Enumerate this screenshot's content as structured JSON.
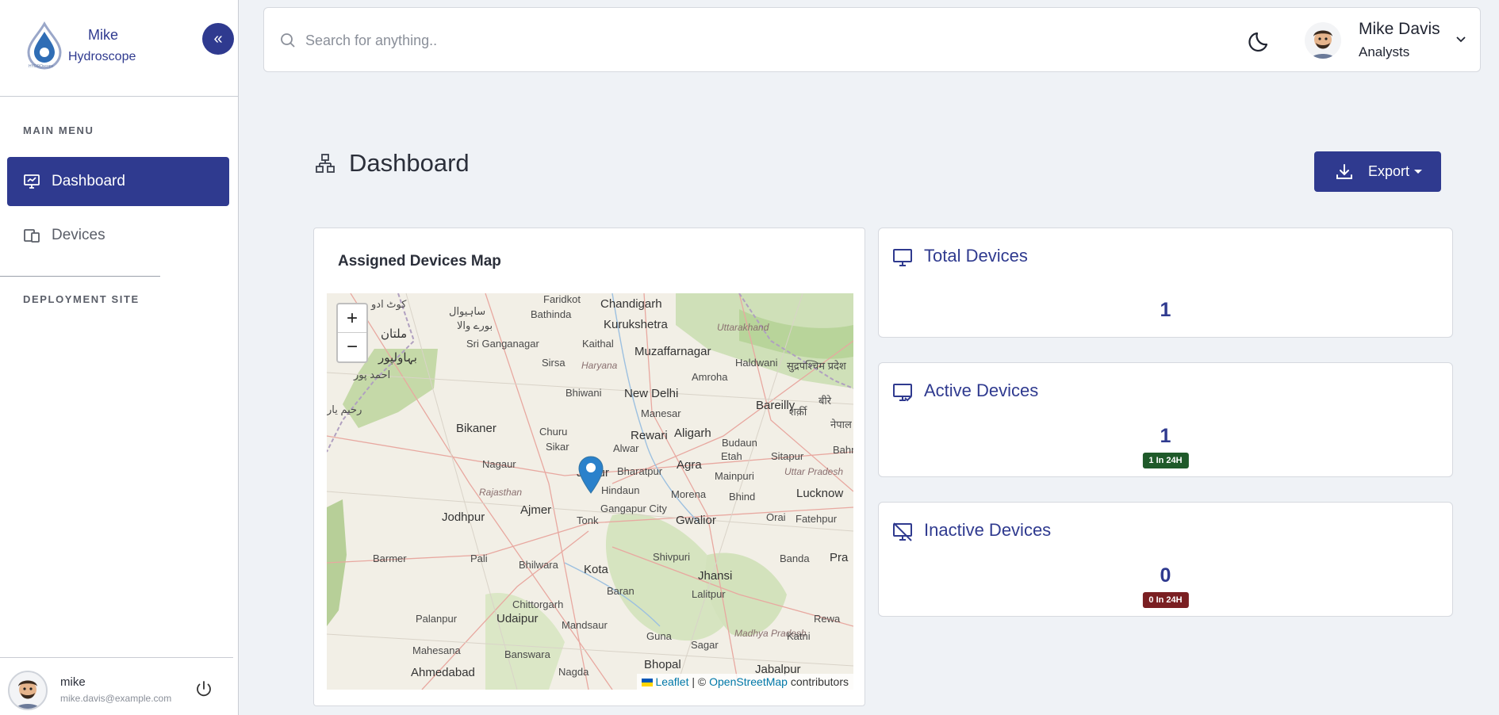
{
  "sidebar": {
    "brand_line1": "Mike",
    "brand_line2": "Hydroscope",
    "logo_caption": "HYDROscope",
    "collapse_glyph": "«",
    "main_menu_title": "MAIN MENU",
    "items": [
      {
        "label": "Dashboard",
        "icon": "monitor-chart-icon",
        "active": true
      },
      {
        "label": "Devices",
        "icon": "devices-icon",
        "active": false
      }
    ],
    "deployment_title": "DEPLOYMENT SITE",
    "footer": {
      "name": "mike",
      "email": "mike.davis@example.com"
    }
  },
  "topbar": {
    "search_placeholder": "Search for anything..",
    "profile_name": "Mike Davis",
    "profile_role": "Analysts"
  },
  "page": {
    "title": "Dashboard",
    "export_label": "Export"
  },
  "map_card": {
    "title": "Assigned Devices Map",
    "zoom_in": "+",
    "zoom_out": "−",
    "attribution_leaflet": "Leaflet",
    "attribution_sep": " | © ",
    "attribution_osm": "OpenStreetMap",
    "attribution_tail": " contributors",
    "labels": [
      {
        "t": "Faridkot",
        "c": ""
      },
      {
        "t": "Chandigarh",
        "c": "big"
      },
      {
        "t": "Bathinda",
        "c": ""
      },
      {
        "t": "Kurukshetra",
        "c": "big"
      },
      {
        "t": "Uttarakhand",
        "c": "italic"
      },
      {
        "t": "Sri Ganganagar",
        "c": ""
      },
      {
        "t": "Kaithal",
        "c": ""
      },
      {
        "t": "Muzaffarnagar",
        "c": "big"
      },
      {
        "t": "Sirsa",
        "c": ""
      },
      {
        "t": "Haryana",
        "c": "italic"
      },
      {
        "t": "Haldwani",
        "c": ""
      },
      {
        "t": "Amroha",
        "c": ""
      },
      {
        "t": "Bhiwani",
        "c": ""
      },
      {
        "t": "New Delhi",
        "c": "big"
      },
      {
        "t": "Manesar",
        "c": ""
      },
      {
        "t": "Bareilly",
        "c": "big"
      },
      {
        "t": "Bikaner",
        "c": "big"
      },
      {
        "t": "Churu",
        "c": ""
      },
      {
        "t": "Rewari",
        "c": "big"
      },
      {
        "t": "Aligarh",
        "c": "big"
      },
      {
        "t": "Budaun",
        "c": ""
      },
      {
        "t": "Sikar",
        "c": ""
      },
      {
        "t": "Alwar",
        "c": ""
      },
      {
        "t": "Nagaur",
        "c": ""
      },
      {
        "t": "Bharatpur",
        "c": ""
      },
      {
        "t": "Agra",
        "c": "big"
      },
      {
        "t": "Etah",
        "c": ""
      },
      {
        "t": "Sitapur",
        "c": ""
      },
      {
        "t": "Jaipur",
        "c": "big"
      },
      {
        "t": "Mainpuri",
        "c": ""
      },
      {
        "t": "Uttar Pradesh",
        "c": "italic"
      },
      {
        "t": "Rajasthan",
        "c": "italic"
      },
      {
        "t": "Hindaun",
        "c": ""
      },
      {
        "t": "Morena",
        "c": ""
      },
      {
        "t": "Lucknow",
        "c": "big"
      },
      {
        "t": "Bhind",
        "c": ""
      },
      {
        "t": "Ajmer",
        "c": "big"
      },
      {
        "t": "Gangapur City",
        "c": ""
      },
      {
        "t": "Jodhpur",
        "c": "big"
      },
      {
        "t": "Tonk",
        "c": ""
      },
      {
        "t": "Gwalior",
        "c": "big"
      },
      {
        "t": "Orai",
        "c": ""
      },
      {
        "t": "Fatehpur",
        "c": ""
      },
      {
        "t": "Barmer",
        "c": ""
      },
      {
        "t": "Pali",
        "c": ""
      },
      {
        "t": "Bhilwara",
        "c": ""
      },
      {
        "t": "Shivpuri",
        "c": ""
      },
      {
        "t": "Banda",
        "c": ""
      },
      {
        "t": "Kota",
        "c": "big"
      },
      {
        "t": "Jhansi",
        "c": "big"
      },
      {
        "t": "Baran",
        "c": ""
      },
      {
        "t": "Lalitpur",
        "c": ""
      },
      {
        "t": "Chittorgarh",
        "c": ""
      },
      {
        "t": "Palanpur",
        "c": ""
      },
      {
        "t": "Udaipur",
        "c": "big"
      },
      {
        "t": "Mandsaur",
        "c": ""
      },
      {
        "t": "Guna",
        "c": ""
      },
      {
        "t": "Madhya Pradesh",
        "c": "italic"
      },
      {
        "t": "Katni",
        "c": ""
      },
      {
        "t": "Rewa",
        "c": ""
      },
      {
        "t": "Mahesana",
        "c": ""
      },
      {
        "t": "Banswara",
        "c": ""
      },
      {
        "t": "Sagar",
        "c": ""
      },
      {
        "t": "Bhopal",
        "c": "big"
      },
      {
        "t": "Ahmedabad",
        "c": "big"
      },
      {
        "t": "Nagda",
        "c": ""
      },
      {
        "t": "Jabalpur",
        "c": "big"
      },
      {
        "t": "Pra",
        "c": "big"
      },
      {
        "t": "Bahr",
        "c": ""
      },
      {
        "t": "ملتان",
        "c": "big"
      },
      {
        "t": "بہاولپور",
        "c": "big"
      },
      {
        "t": "رحیم یار",
        "c": ""
      },
      {
        "t": "احمد پور",
        "c": ""
      },
      {
        "t": "کوٹ ادو",
        "c": ""
      },
      {
        "t": "ساہیوال",
        "c": ""
      },
      {
        "t": "بورے والا",
        "c": ""
      },
      {
        "t": "शर्क़ी",
        "c": ""
      },
      {
        "t": "सुद्रपश्चिम प्रदेश",
        "c": ""
      },
      {
        "t": "नेपाल",
        "c": ""
      },
      {
        "t": "बीरे",
        "c": ""
      }
    ]
  },
  "stats": [
    {
      "title": "Total Devices",
      "value": "1",
      "badge": "",
      "icon": "monitor-icon"
    },
    {
      "title": "Active Devices",
      "value": "1",
      "badge": "1 In 24H",
      "badge_color": "#1f5a2a",
      "icon": "monitor-check-icon"
    },
    {
      "title": "Inactive Devices",
      "value": "0",
      "badge": "0 In 24H",
      "badge_color": "#7a1f22",
      "icon": "monitor-off-icon"
    }
  ],
  "colors": {
    "accent": "#2f3a8f",
    "active_badge": "#1f5a2a",
    "inactive_badge": "#7a1f22"
  }
}
